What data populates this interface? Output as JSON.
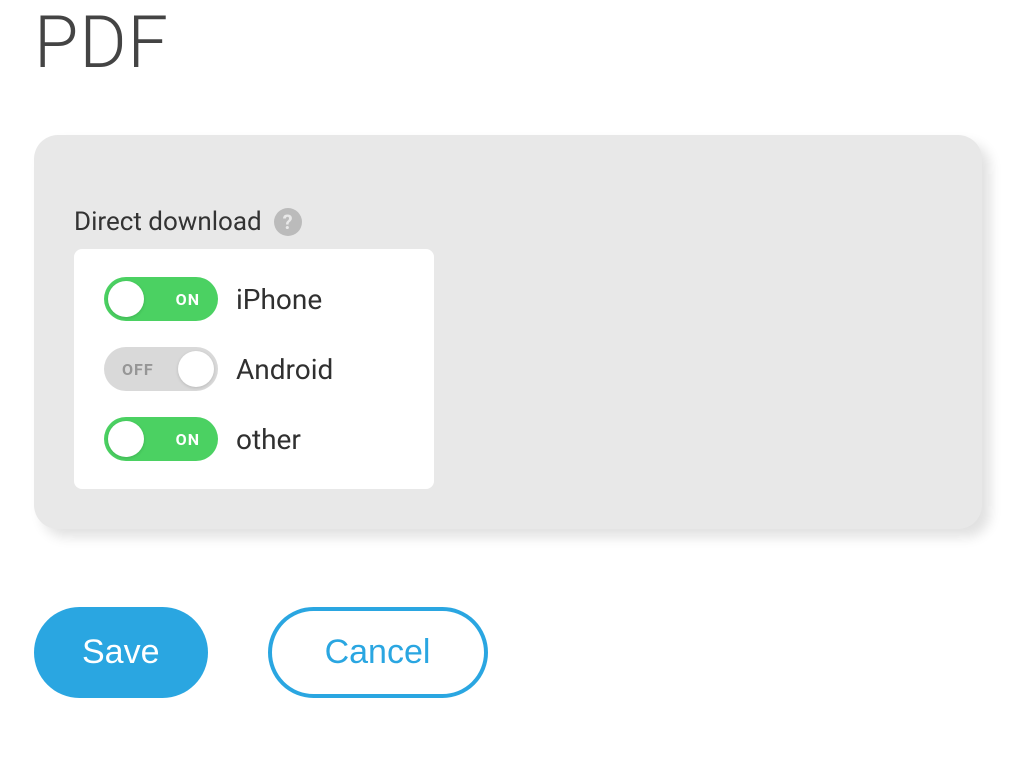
{
  "page": {
    "title": "PDF"
  },
  "panel": {
    "label": "Direct download",
    "toggles": [
      {
        "label": "iPhone",
        "state": "on",
        "state_text": "ON"
      },
      {
        "label": "Android",
        "state": "off",
        "state_text": "OFF"
      },
      {
        "label": "other",
        "state": "on",
        "state_text": "ON"
      }
    ]
  },
  "actions": {
    "save_label": "Save",
    "cancel_label": "Cancel"
  }
}
